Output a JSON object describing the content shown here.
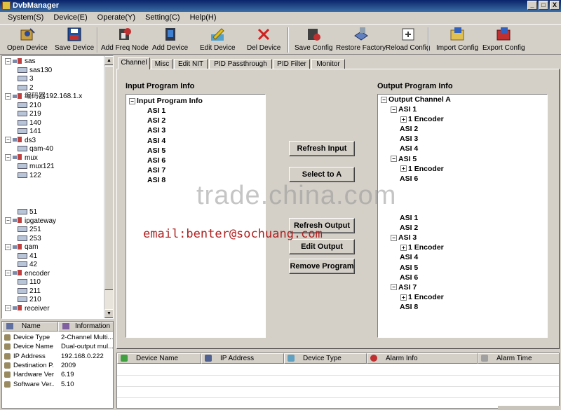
{
  "window": {
    "title": "DvbManager",
    "min": "_",
    "max": "□",
    "close": "X"
  },
  "menu": [
    "System(S)",
    "Device(E)",
    "Operate(Y)",
    "Setting(C)",
    "Help(H)"
  ],
  "toolbar": [
    {
      "label": "Open Device",
      "icon": "open-device-icon"
    },
    {
      "label": "Save Device",
      "icon": "save-device-icon"
    },
    {
      "label": "Add Freq Node",
      "icon": "add-freq-node-icon"
    },
    {
      "label": "Add Device",
      "icon": "add-device-icon"
    },
    {
      "label": "Edit Device",
      "icon": "edit-device-icon"
    },
    {
      "label": "Del Device",
      "icon": "del-device-icon"
    },
    {
      "label": "Save Config",
      "icon": "save-config-icon"
    },
    {
      "label": "Restore Factory",
      "icon": "restore-factory-icon"
    },
    {
      "label": "Reload Config",
      "icon": "reload-config-icon"
    },
    {
      "label": "Import Config",
      "icon": "import-config-icon"
    },
    {
      "label": "Export Config",
      "icon": "export-config-icon"
    }
  ],
  "tree": {
    "groups": [
      {
        "name": "sas",
        "children": [
          "sas130",
          "3",
          "2"
        ]
      },
      {
        "name": "编码器192.168.1.x",
        "children": [
          "210",
          "219",
          "140",
          "141"
        ]
      },
      {
        "name": "ds3",
        "children": [
          "qam-40"
        ]
      },
      {
        "name": "mux",
        "children": [
          "mux121",
          "122"
        ]
      },
      {
        "name": "",
        "children": [
          "51"
        ]
      },
      {
        "name": "ipgateway",
        "children": [
          "251",
          "253"
        ]
      },
      {
        "name": "qam",
        "children": [
          "41",
          "42"
        ]
      },
      {
        "name": "encoder",
        "children": [
          "110",
          "211",
          "210"
        ]
      },
      {
        "name": "receiver",
        "children": []
      }
    ]
  },
  "info": {
    "headers": {
      "name": "Name",
      "value": "Information"
    },
    "rows": [
      {
        "k": "Device Type",
        "v": "2-Channel Multi..."
      },
      {
        "k": "Device Name",
        "v": "Dual-output mul..."
      },
      {
        "k": "IP Address",
        "v": "192.168.0.222"
      },
      {
        "k": "Destination P...",
        "v": "2009"
      },
      {
        "k": "Hardware Ver...",
        "v": "6.19"
      },
      {
        "k": "Software Ver...",
        "v": "5.10"
      }
    ]
  },
  "tabs": [
    "Channel",
    "Misc",
    "Edit NIT",
    "PID Passthrough",
    "PID Filter",
    "Monitor"
  ],
  "channel": {
    "input_label": "Input Program Info",
    "input_root": "Input Program Info",
    "input_items": [
      "ASI 1",
      "ASI 2",
      "ASI 3",
      "ASI 4",
      "ASI 5",
      "ASI 6",
      "ASI 7",
      "ASI 8"
    ],
    "output_label": "Output Program Info",
    "output_root": "Output Channel A",
    "output_top": [
      {
        "t": "ASI 1",
        "exp": true
      },
      {
        "t": "1 Encoder",
        "sub": true
      },
      {
        "t": "ASI 2"
      },
      {
        "t": "ASI 3"
      },
      {
        "t": "ASI 4"
      },
      {
        "t": "ASI 5",
        "exp": true
      },
      {
        "t": "1 Encoder",
        "sub": true
      },
      {
        "t": "ASI 6"
      }
    ],
    "output_bottom": [
      {
        "t": "ASI 1"
      },
      {
        "t": "ASI 2"
      },
      {
        "t": "ASI 3",
        "exp": true
      },
      {
        "t": "1 Encoder",
        "sub": true
      },
      {
        "t": "ASI 4"
      },
      {
        "t": "ASI 5"
      },
      {
        "t": "ASI 6"
      },
      {
        "t": "ASI 7",
        "exp": true
      },
      {
        "t": "1 Encoder",
        "sub": true
      },
      {
        "t": "ASI 8"
      }
    ],
    "buttons": {
      "refresh_input": "Refresh Input",
      "select_a": "Select to A",
      "refresh_output": "Refresh Output",
      "edit_output": "Edit Output",
      "remove_program": "Remove Program"
    }
  },
  "alarm_headers": [
    "Device Name",
    "IP Address",
    "Device Type",
    "Alarm Info",
    "Alarm Time"
  ],
  "overlay": {
    "watermark": "trade.china.com",
    "email": "email:benter@sochuang.com"
  }
}
